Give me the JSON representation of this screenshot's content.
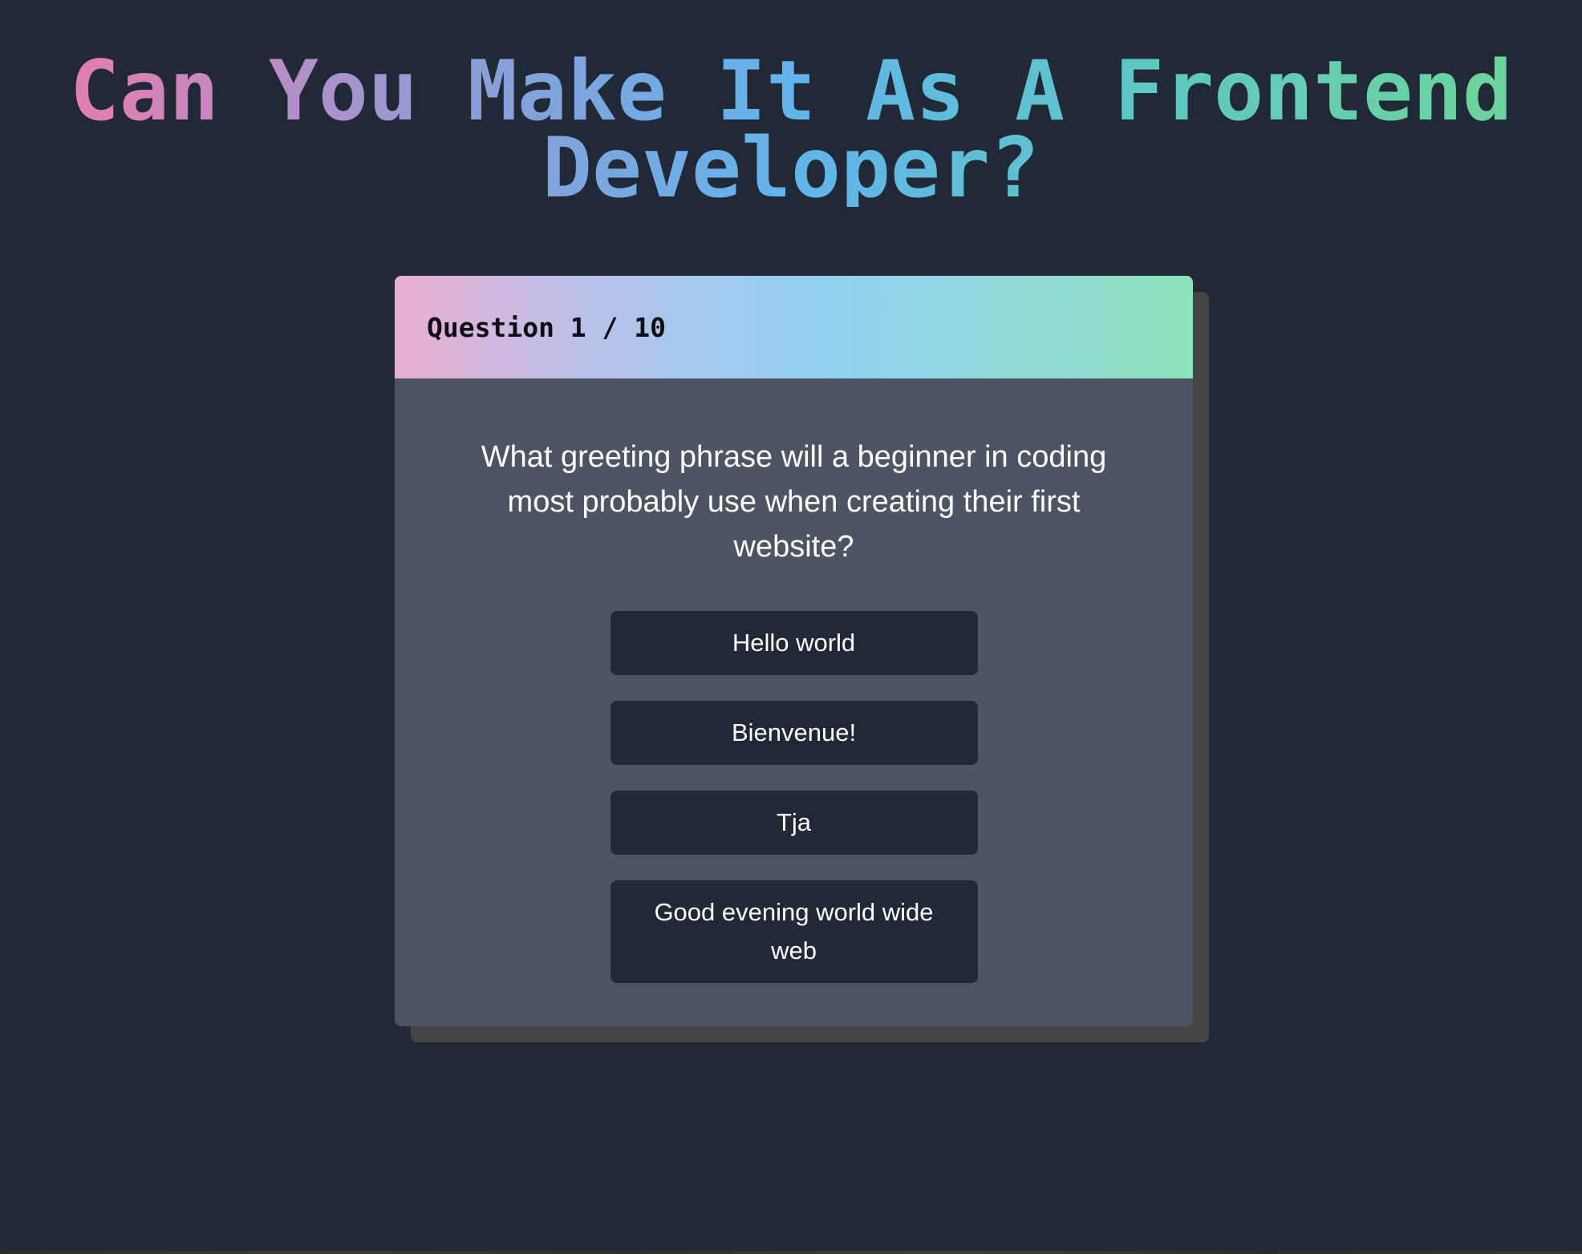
{
  "page": {
    "title": "Can You Make It As A Frontend Developer?"
  },
  "quiz": {
    "counter": "Question 1 / 10",
    "question": "What greeting phrase will a beginner in coding most probably use when creating their first website?",
    "current_question": 1,
    "total_questions": 10,
    "answers": [
      {
        "label": "Hello world"
      },
      {
        "label": "Bienvenue!"
      },
      {
        "label": "Tja"
      },
      {
        "label": "Good evening world wide web"
      }
    ]
  },
  "colors": {
    "background": "#212836",
    "card": "#4e5562",
    "card_shadow": "#444547",
    "answer_button": "#212836",
    "header_gradient": [
      "#ebaed3",
      "#93cdf3",
      "#8ae3b9"
    ],
    "title_gradient": [
      "#e07fb4",
      "#62b4ec",
      "#6cd39d"
    ]
  }
}
